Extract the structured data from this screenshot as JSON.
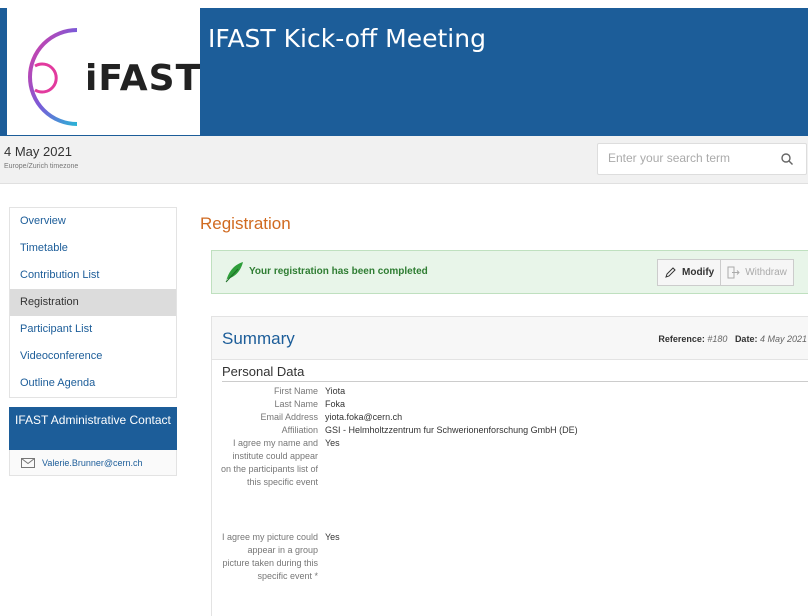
{
  "header": {
    "logo_text": "iFAST",
    "event_title": "IFAST Kick-off Meeting",
    "accent": "#1c5d99"
  },
  "datebar": {
    "date": "4 May 2021",
    "timezone": "Europe/Zurich timezone",
    "search_placeholder": "Enter your search term",
    "search_icon": "search-icon"
  },
  "sidebar": {
    "items": [
      {
        "label": "Overview",
        "active": false
      },
      {
        "label": "Timetable",
        "active": false
      },
      {
        "label": "Contribution List",
        "active": false
      },
      {
        "label": "Registration",
        "active": true
      },
      {
        "label": "Participant List",
        "active": false
      },
      {
        "label": "Videoconference",
        "active": false
      },
      {
        "label": "Outline Agenda",
        "active": false
      }
    ],
    "admin_title": "IFAST Administrative Contact",
    "admin_email": "Valerie.Brunner@cern.ch"
  },
  "main": {
    "page_title": "Registration",
    "title_color": "#d06a20",
    "registration_message": "Your registration has been completed",
    "modify_label": "Modify",
    "withdraw_label": "Withdraw",
    "summary_title": "Summary",
    "reference_label": "Reference:",
    "reference_value": "#180",
    "date_label": "Date:",
    "date_value": "4 May 2021",
    "personal_data_title": "Personal Data",
    "fields": [
      {
        "label": "First Name",
        "value": "Yiota"
      },
      {
        "label": "Last Name",
        "value": "Foka"
      },
      {
        "label": "Email Address",
        "value": "yiota.foka@cern.ch"
      },
      {
        "label": "Affiliation",
        "value": "GSI - Helmholtzzentrum fur Schwerionenforschung GmbH (DE)"
      },
      {
        "label": "I agree my name and institute could appear on the participants list of this specific event",
        "value": "Yes"
      },
      {
        "label": "I agree my picture could appear in a group picture taken during this specific event *",
        "value": "Yes"
      }
    ]
  }
}
